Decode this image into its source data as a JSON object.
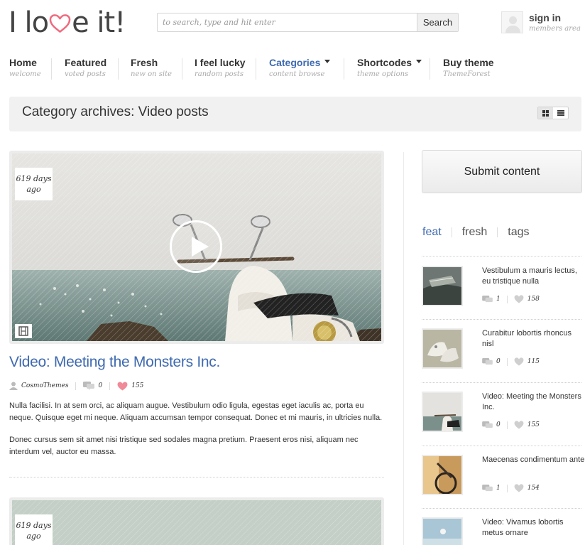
{
  "header": {
    "logo_left": "I lo",
    "logo_right": "e it!",
    "search_placeholder": "to search, type and hit enter",
    "search_button": "Search",
    "signin_title": "sign in",
    "signin_sub": "members area"
  },
  "nav": {
    "items": [
      {
        "label": "Home",
        "sub": "welcome"
      },
      {
        "label": "Featured",
        "sub": "voted posts"
      },
      {
        "label": "Fresh",
        "sub": "new on site"
      },
      {
        "label": "I feel lucky",
        "sub": "random posts"
      },
      {
        "label": "Categories",
        "sub": "content browse",
        "active": true,
        "dropdown": true
      },
      {
        "label": "Shortcodes",
        "sub": "theme options",
        "dropdown": true
      },
      {
        "label": "Buy theme",
        "sub": "ThemeForest"
      }
    ]
  },
  "archive": {
    "title": "Category archives: Video posts",
    "view_modes": [
      "grid-icon",
      "list-icon"
    ],
    "active_view": "grid"
  },
  "posts": [
    {
      "date_line1": "619 days",
      "date_line2": "ago",
      "title": "Video: Meeting the Monsters Inc.",
      "author": "CosmoThemes",
      "comments": "0",
      "likes": "155",
      "paragraph1": "Nulla facilisi. In at sem orci, ac aliquam augue. Vestibulum odio ligula, egestas eget iaculis ac, porta eu neque. Quisque eget mi neque. Aliquam accumsan tempor consequat. Donec et mi mauris, in ultricies nulla.",
      "paragraph2": "Donec cursus sem sit amet nisi tristique sed sodales magna pretium. Praesent eros nisi, aliquam nec interdum vel, auctor eu massa."
    },
    {
      "date_line1": "619 days",
      "date_line2": "ago"
    }
  ],
  "sidebar": {
    "submit_label": "Submit content",
    "tabs": [
      "feat",
      "fresh",
      "tags"
    ],
    "active_tab": "feat",
    "items": [
      {
        "title": "Vestibulum a mauris lectus, eu tristique nulla",
        "comments": "1",
        "likes": "158"
      },
      {
        "title": "Curabitur lobortis rhoncus nisl",
        "comments": "0",
        "likes": "115"
      },
      {
        "title": "Video: Meeting the Monsters Inc.",
        "comments": "0",
        "likes": "155"
      },
      {
        "title": "Maecenas condimentum ante",
        "comments": "1",
        "likes": "154"
      },
      {
        "title": "Video: Vivamus lobortis metus ornare",
        "comments": "",
        "likes": ""
      }
    ]
  },
  "colors": {
    "accent": "#3e6ab0",
    "heart": "#f06b7e",
    "text": "#333333",
    "muted": "#aaaaaa"
  }
}
